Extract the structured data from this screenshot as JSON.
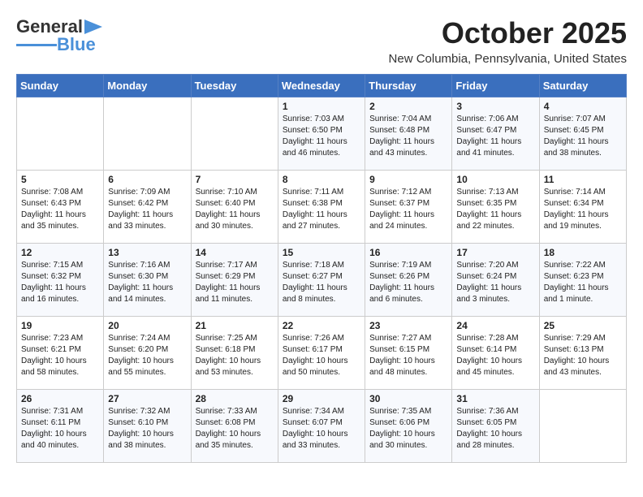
{
  "header": {
    "logo_line1": "General",
    "logo_line2": "Blue",
    "month": "October 2025",
    "location": "New Columbia, Pennsylvania, United States"
  },
  "weekdays": [
    "Sunday",
    "Monday",
    "Tuesday",
    "Wednesday",
    "Thursday",
    "Friday",
    "Saturday"
  ],
  "weeks": [
    [
      {
        "day": "",
        "info": ""
      },
      {
        "day": "",
        "info": ""
      },
      {
        "day": "",
        "info": ""
      },
      {
        "day": "1",
        "info": "Sunrise: 7:03 AM\nSunset: 6:50 PM\nDaylight: 11 hours\nand 46 minutes."
      },
      {
        "day": "2",
        "info": "Sunrise: 7:04 AM\nSunset: 6:48 PM\nDaylight: 11 hours\nand 43 minutes."
      },
      {
        "day": "3",
        "info": "Sunrise: 7:06 AM\nSunset: 6:47 PM\nDaylight: 11 hours\nand 41 minutes."
      },
      {
        "day": "4",
        "info": "Sunrise: 7:07 AM\nSunset: 6:45 PM\nDaylight: 11 hours\nand 38 minutes."
      }
    ],
    [
      {
        "day": "5",
        "info": "Sunrise: 7:08 AM\nSunset: 6:43 PM\nDaylight: 11 hours\nand 35 minutes."
      },
      {
        "day": "6",
        "info": "Sunrise: 7:09 AM\nSunset: 6:42 PM\nDaylight: 11 hours\nand 33 minutes."
      },
      {
        "day": "7",
        "info": "Sunrise: 7:10 AM\nSunset: 6:40 PM\nDaylight: 11 hours\nand 30 minutes."
      },
      {
        "day": "8",
        "info": "Sunrise: 7:11 AM\nSunset: 6:38 PM\nDaylight: 11 hours\nand 27 minutes."
      },
      {
        "day": "9",
        "info": "Sunrise: 7:12 AM\nSunset: 6:37 PM\nDaylight: 11 hours\nand 24 minutes."
      },
      {
        "day": "10",
        "info": "Sunrise: 7:13 AM\nSunset: 6:35 PM\nDaylight: 11 hours\nand 22 minutes."
      },
      {
        "day": "11",
        "info": "Sunrise: 7:14 AM\nSunset: 6:34 PM\nDaylight: 11 hours\nand 19 minutes."
      }
    ],
    [
      {
        "day": "12",
        "info": "Sunrise: 7:15 AM\nSunset: 6:32 PM\nDaylight: 11 hours\nand 16 minutes."
      },
      {
        "day": "13",
        "info": "Sunrise: 7:16 AM\nSunset: 6:30 PM\nDaylight: 11 hours\nand 14 minutes."
      },
      {
        "day": "14",
        "info": "Sunrise: 7:17 AM\nSunset: 6:29 PM\nDaylight: 11 hours\nand 11 minutes."
      },
      {
        "day": "15",
        "info": "Sunrise: 7:18 AM\nSunset: 6:27 PM\nDaylight: 11 hours\nand 8 minutes."
      },
      {
        "day": "16",
        "info": "Sunrise: 7:19 AM\nSunset: 6:26 PM\nDaylight: 11 hours\nand 6 minutes."
      },
      {
        "day": "17",
        "info": "Sunrise: 7:20 AM\nSunset: 6:24 PM\nDaylight: 11 hours\nand 3 minutes."
      },
      {
        "day": "18",
        "info": "Sunrise: 7:22 AM\nSunset: 6:23 PM\nDaylight: 11 hours\nand 1 minute."
      }
    ],
    [
      {
        "day": "19",
        "info": "Sunrise: 7:23 AM\nSunset: 6:21 PM\nDaylight: 10 hours\nand 58 minutes."
      },
      {
        "day": "20",
        "info": "Sunrise: 7:24 AM\nSunset: 6:20 PM\nDaylight: 10 hours\nand 55 minutes."
      },
      {
        "day": "21",
        "info": "Sunrise: 7:25 AM\nSunset: 6:18 PM\nDaylight: 10 hours\nand 53 minutes."
      },
      {
        "day": "22",
        "info": "Sunrise: 7:26 AM\nSunset: 6:17 PM\nDaylight: 10 hours\nand 50 minutes."
      },
      {
        "day": "23",
        "info": "Sunrise: 7:27 AM\nSunset: 6:15 PM\nDaylight: 10 hours\nand 48 minutes."
      },
      {
        "day": "24",
        "info": "Sunrise: 7:28 AM\nSunset: 6:14 PM\nDaylight: 10 hours\nand 45 minutes."
      },
      {
        "day": "25",
        "info": "Sunrise: 7:29 AM\nSunset: 6:13 PM\nDaylight: 10 hours\nand 43 minutes."
      }
    ],
    [
      {
        "day": "26",
        "info": "Sunrise: 7:31 AM\nSunset: 6:11 PM\nDaylight: 10 hours\nand 40 minutes."
      },
      {
        "day": "27",
        "info": "Sunrise: 7:32 AM\nSunset: 6:10 PM\nDaylight: 10 hours\nand 38 minutes."
      },
      {
        "day": "28",
        "info": "Sunrise: 7:33 AM\nSunset: 6:08 PM\nDaylight: 10 hours\nand 35 minutes."
      },
      {
        "day": "29",
        "info": "Sunrise: 7:34 AM\nSunset: 6:07 PM\nDaylight: 10 hours\nand 33 minutes."
      },
      {
        "day": "30",
        "info": "Sunrise: 7:35 AM\nSunset: 6:06 PM\nDaylight: 10 hours\nand 30 minutes."
      },
      {
        "day": "31",
        "info": "Sunrise: 7:36 AM\nSunset: 6:05 PM\nDaylight: 10 hours\nand 28 minutes."
      },
      {
        "day": "",
        "info": ""
      }
    ]
  ]
}
